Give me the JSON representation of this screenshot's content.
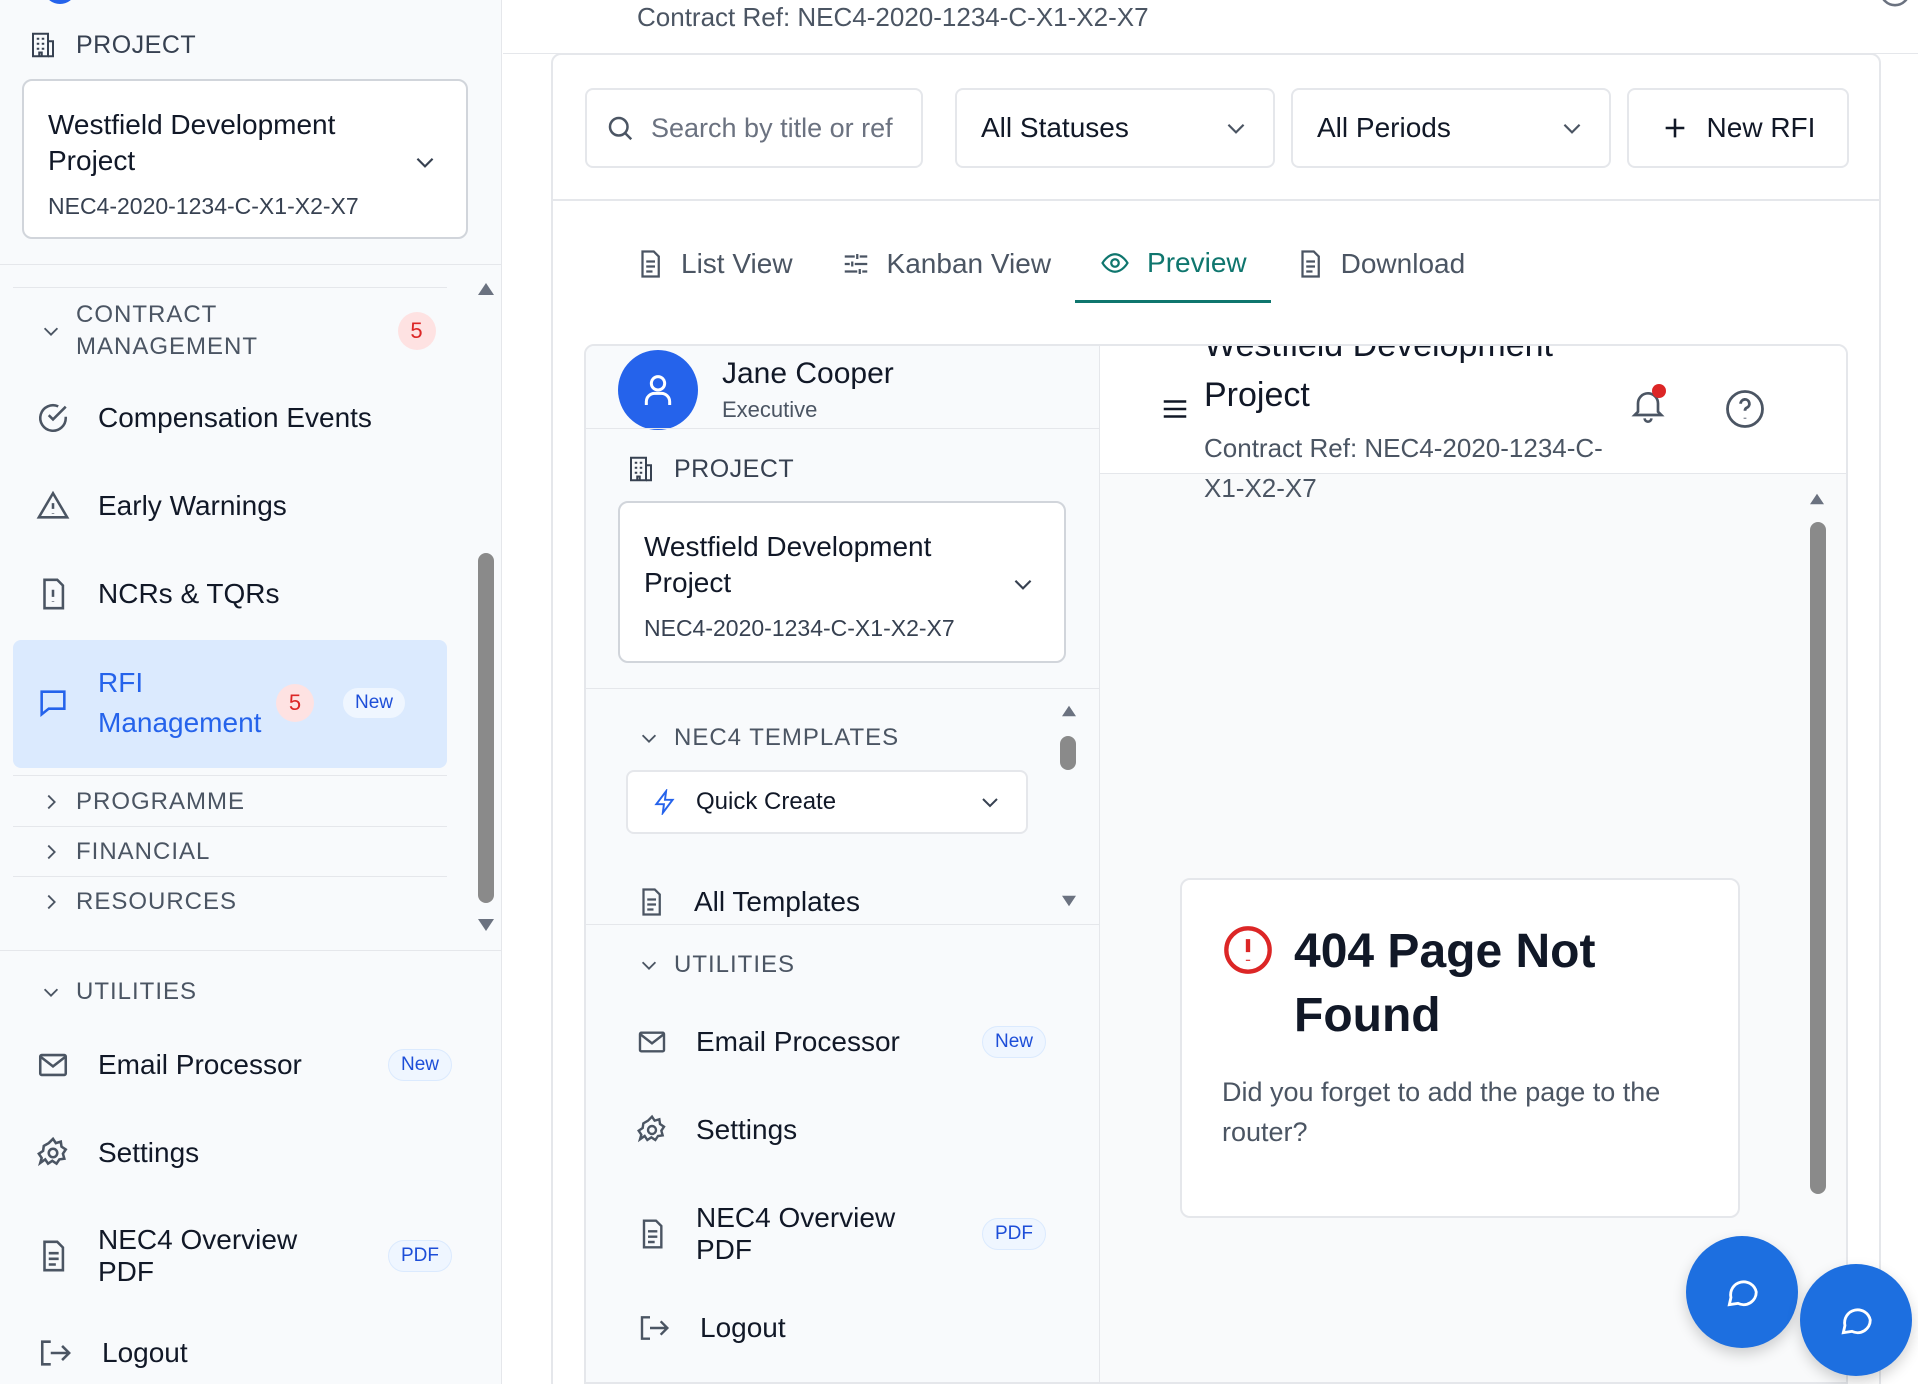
{
  "sidebar": {
    "project_heading": "PROJECT",
    "project_name": "Westfield Development Project",
    "project_ref": "NEC4-2020-1234-C-X1-X2-X7",
    "contract_group": {
      "label": "CONTRACT MANAGEMENT",
      "badge": "5"
    },
    "items": [
      {
        "label": "Compensation Events",
        "icon": "check-circle-icon"
      },
      {
        "label": "Early Warnings",
        "icon": "warning-triangle-icon"
      },
      {
        "label": "NCRs & TQRs",
        "icon": "document-alert-icon"
      },
      {
        "label": "RFI Management",
        "icon": "chat-icon",
        "badge": "5",
        "pill": "New"
      }
    ],
    "groups": [
      "PROGRAMME",
      "FINANCIAL",
      "RESOURCES"
    ],
    "utilities": {
      "label": "UTILITIES",
      "items": [
        {
          "label": "Email Processor",
          "pill": "New"
        },
        {
          "label": "Settings"
        },
        {
          "label": "NEC4 Overview PDF",
          "pill": "PDF"
        },
        {
          "label": "Logout"
        }
      ]
    }
  },
  "topbar": {
    "contract_ref": "Contract Ref: NEC4-2020-1234-C-X1-X2-X7"
  },
  "filters": {
    "search_placeholder": "Search by title or ref",
    "status_select": "All Statuses",
    "period_select": "All Periods",
    "new_button": "New RFI"
  },
  "tabs": [
    {
      "label": "List View",
      "active": false
    },
    {
      "label": "Kanban View",
      "active": false
    },
    {
      "label": "Preview",
      "active": true
    },
    {
      "label": "Download",
      "active": false
    }
  ],
  "preview": {
    "user": {
      "name": "Jane Cooper",
      "role": "Executive"
    },
    "project_heading": "PROJECT",
    "project_name": "Westfield Development Project",
    "project_ref": "NEC4-2020-1234-C-X1-X2-X7",
    "templates_group": "NEC4 TEMPLATES",
    "quick_create": "Quick Create",
    "all_templates": "All Templates",
    "utilities_group": "UTILITIES",
    "utilities": [
      {
        "label": "Email Processor",
        "pill": "New"
      },
      {
        "label": "Settings"
      },
      {
        "label": "NEC4 Overview PDF",
        "pill": "PDF"
      },
      {
        "label": "Logout"
      }
    ],
    "header_title": "Westfield Development Project",
    "header_ref": "Contract Ref: NEC4-2020-1234-C-X1-X2-X7",
    "error_title": "404 Page Not Found",
    "error_text": "Did you forget to add the page to the router?"
  },
  "colors": {
    "accent": "#2563eb",
    "tab_active": "#0f766e",
    "badge": "#dc2626",
    "fab": "#1d6fe0"
  }
}
